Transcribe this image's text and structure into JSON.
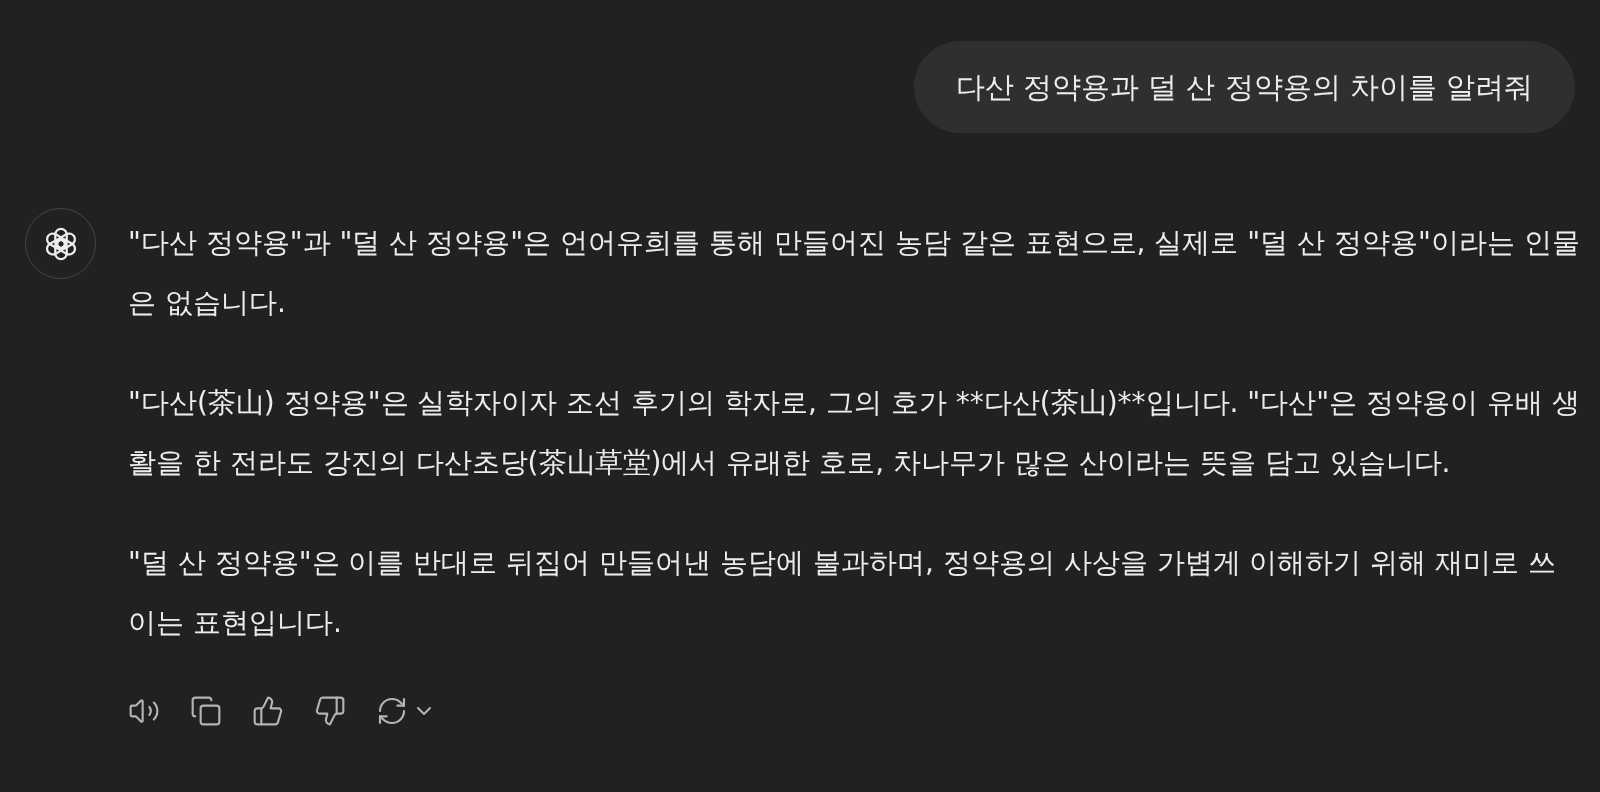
{
  "user_message": "다산 정약용과 덜 산 정약용의 차이를 알려줘",
  "assistant": {
    "paragraphs": [
      "\"다산 정약용\"과 \"덜 산 정약용\"은 언어유희를 통해 만들어진 농담 같은 표현으로, 실제로 \"덜 산 정약용\"이라는 인물은 없습니다.",
      "\"다산(茶山) 정약용\"은 실학자이자 조선 후기의 학자로, 그의 호가 **다산(茶山)**입니다. \"다산\"은 정약용이 유배 생활을 한 전라도 강진의 다산초당(茶山草堂)에서 유래한 호로, 차나무가 많은 산이라는 뜻을 담고 있습니다.",
      "\"덜 산 정약용\"은 이를 반대로 뒤집어 만들어낸 농담에 불과하며, 정약용의 사상을 가볍게 이해하기 위해 재미로 쓰이는 표현입니다."
    ]
  },
  "actions": [
    {
      "kind": "read-aloud"
    },
    {
      "kind": "copy"
    },
    {
      "kind": "like"
    },
    {
      "kind": "dislike"
    },
    {
      "kind": "regenerate"
    }
  ]
}
